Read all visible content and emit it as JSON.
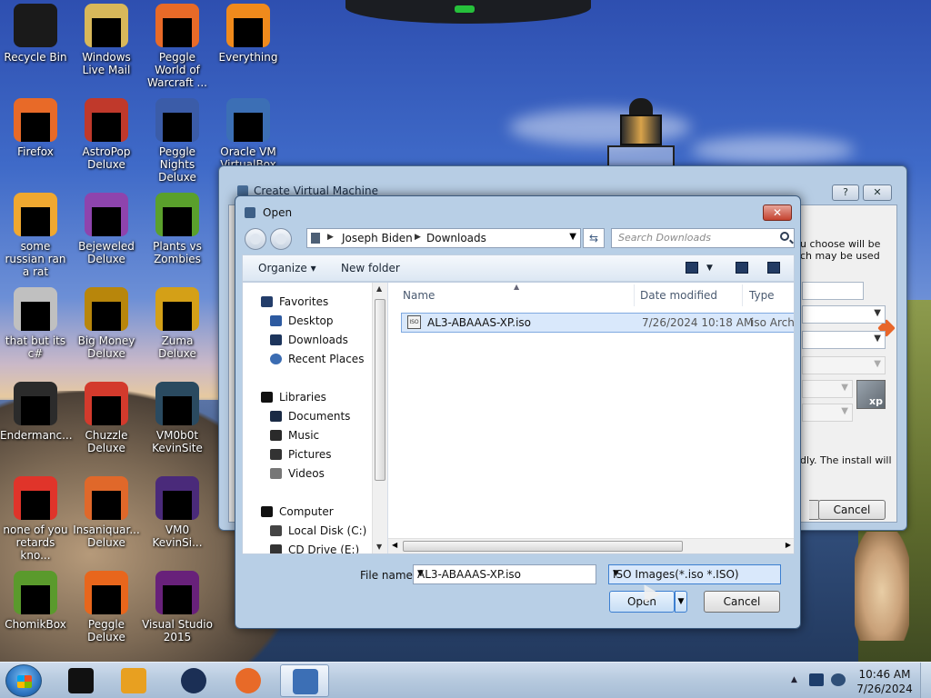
{
  "desktop_icons": [
    {
      "label": "Recycle Bin",
      "icon": "recycle-bin-icon",
      "color": "#1a1a1a"
    },
    {
      "label": "Windows Live Mail",
      "icon": "mail-icon",
      "color": "#d8b85a"
    },
    {
      "label": "Peggle World of Warcraft ...",
      "icon": "peggle-icon",
      "color": "#e86a28"
    },
    {
      "label": "Everything",
      "icon": "search-app-icon",
      "color": "#f08a1c"
    },
    {
      "label": "Firefox",
      "icon": "firefox-icon",
      "color": "#e86a28"
    },
    {
      "label": "AstroPop Deluxe",
      "icon": "game-icon",
      "color": "#c0392b"
    },
    {
      "label": "Peggle Nights Deluxe",
      "icon": "peggle-icon",
      "color": "#3b5ca8"
    },
    {
      "label": "Oracle VM VirtualBox",
      "icon": "virtualbox-icon",
      "color": "#3c6fb5"
    },
    {
      "label": "some russian ran a rat",
      "icon": "app-icon",
      "color": "#f0a830"
    },
    {
      "label": "Bejeweled Deluxe",
      "icon": "game-icon",
      "color": "#8e44ad"
    },
    {
      "label": "Plants vs Zombies",
      "icon": "game-icon",
      "color": "#5aa02c"
    },
    {
      "label": "that but its c#",
      "icon": "app-icon",
      "color": "#c0c0c0"
    },
    {
      "label": "Big Money Deluxe",
      "icon": "game-icon",
      "color": "#b8860b"
    },
    {
      "label": "Zuma Deluxe",
      "icon": "game-icon",
      "color": "#d4a017"
    },
    {
      "label": "Endermanc...",
      "icon": "app-icon",
      "color": "#2b2b2b"
    },
    {
      "label": "Chuzzle Deluxe",
      "icon": "game-icon",
      "color": "#d33a2c"
    },
    {
      "label": "VM0b0t KevinSite",
      "icon": "app-icon",
      "color": "#2a4a60"
    },
    {
      "label": "none of you retards kno...",
      "icon": "app-icon",
      "color": "#e0342a"
    },
    {
      "label": "Insaniquar... Deluxe",
      "icon": "game-icon",
      "color": "#e0682a"
    },
    {
      "label": "VM0 KevinSi...",
      "icon": "app-icon",
      "color": "#4a2a7a"
    },
    {
      "label": "ChomikBox",
      "icon": "app-icon",
      "color": "#5a9a2c"
    },
    {
      "label": "Peggle Deluxe",
      "icon": "peggle-icon",
      "color": "#e8661c"
    },
    {
      "label": "Visual Studio 2015",
      "icon": "visual-studio-icon",
      "color": "#68217a"
    }
  ],
  "vm_dialog": {
    "title": "Create Virtual Machine",
    "help_label": "?",
    "close_label": "✕",
    "text_1a": "u choose will be",
    "text_1b": "ch may be used",
    "text_2": "dly. The install will",
    "cancel_label": "Cancel",
    "xp_label": "xp"
  },
  "open_dialog": {
    "title": "Open",
    "close_label": "✕",
    "breadcrumb": [
      "Joseph Biden",
      "Downloads"
    ],
    "search_placeholder": "Search Downloads",
    "toolbar": {
      "organize": "Organize",
      "new_folder": "New folder"
    },
    "nav": {
      "favorites": "Favorites",
      "desktop": "Desktop",
      "downloads": "Downloads",
      "recent": "Recent Places",
      "libraries": "Libraries",
      "documents": "Documents",
      "music": "Music",
      "pictures": "Pictures",
      "videos": "Videos",
      "computer": "Computer",
      "local_disk": "Local Disk (C:)",
      "cd_drive": "CD Drive (E:)"
    },
    "columns": {
      "name": "Name",
      "date": "Date modified",
      "type": "Type"
    },
    "files": [
      {
        "name": "AL3-ABAAAS-XP.iso",
        "date": "7/26/2024 10:18 AM",
        "type": "iso Archiv"
      }
    ],
    "file_name_label": "File name:",
    "file_name_value": "AL3-ABAAAS-XP.iso",
    "filter_value": "ISO Images(*.iso *.ISO)",
    "open_label": "Open",
    "cancel_label": "Cancel"
  },
  "taskbar": {
    "apps": [
      {
        "name": "command-prompt",
        "icon": "terminal-icon",
        "color": "#111111"
      },
      {
        "name": "media-player",
        "icon": "media-player-icon",
        "color": "#e8a020"
      },
      {
        "name": "app-globe",
        "icon": "globe-icon",
        "color": "#1b2f55"
      },
      {
        "name": "firefox",
        "icon": "firefox-icon",
        "color": "#e86a28"
      },
      {
        "name": "virtualbox",
        "icon": "virtualbox-icon",
        "color": "#3c6fb5"
      }
    ],
    "clock_time": "10:46 AM",
    "clock_date": "7/26/2024"
  }
}
